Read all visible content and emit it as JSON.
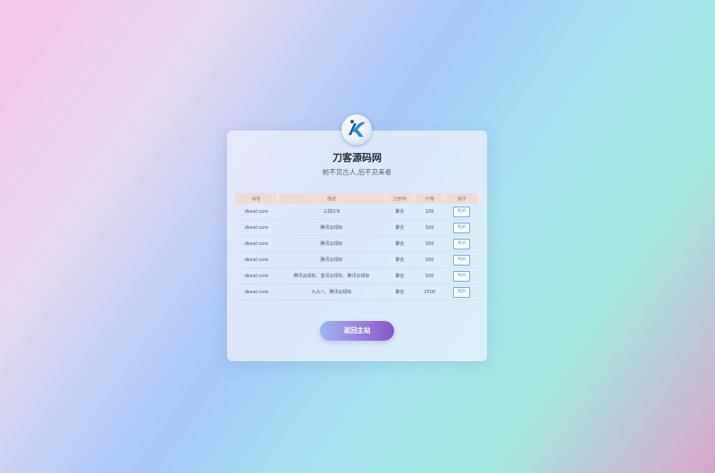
{
  "site": {
    "name": "刀客源码网",
    "slogan": "前不见古人,后不见来者",
    "logo_icon": "dk-logo-icon"
  },
  "table": {
    "headers": [
      "域名",
      "描述",
      "注册商",
      "价格",
      "操作"
    ],
    "rows": [
      {
        "domain": "dkewl.com",
        "desc": "三拼/CN",
        "registrar": "聚名",
        "price": "100",
        "action": "购买"
      },
      {
        "domain": "dkewl.com",
        "desc": "腾讯云绿标",
        "registrar": "聚名",
        "price": "500",
        "action": "购买"
      },
      {
        "domain": "dkewl.com",
        "desc": "腾讯云绿标",
        "registrar": "聚名",
        "price": "500",
        "action": "购买"
      },
      {
        "domain": "dkewl.com",
        "desc": "腾讯云绿标",
        "registrar": "聚名",
        "price": "500",
        "action": "购买"
      },
      {
        "domain": "dkewl.com",
        "desc": "腾讯云绿标、蓝讯云绿标、腾讯云绿标",
        "registrar": "聚名",
        "price": "500",
        "action": "购买"
      },
      {
        "domain": "dkewl.com",
        "desc": "九头八、腾讯云绿标",
        "registrar": "聚名",
        "price": "2500",
        "action": "购买"
      }
    ]
  },
  "back_button": {
    "label": "返回主站"
  },
  "colors": {
    "accent_blue": "#3d8fd4",
    "header_bg": "#eedcd6",
    "button_gradient_end": "#8657c8"
  }
}
